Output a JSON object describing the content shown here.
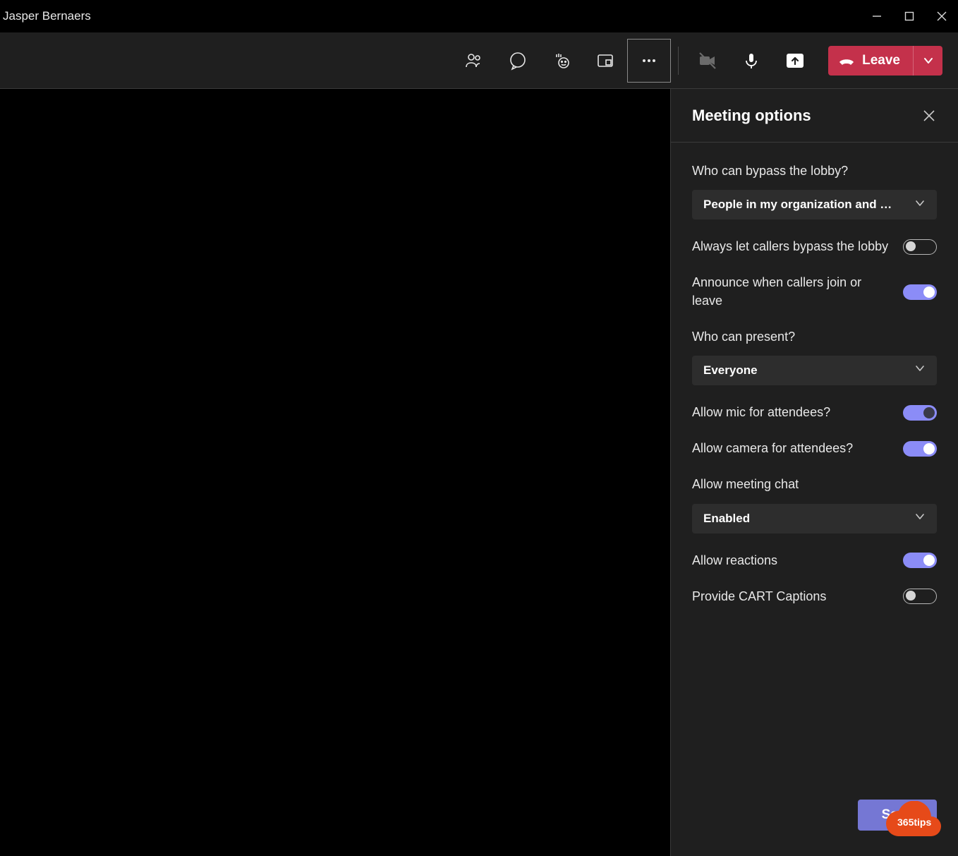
{
  "titlebar": {
    "title": "Jasper Bernaers"
  },
  "toolbar": {
    "leave_label": "Leave",
    "icons": {
      "people": "people-icon",
      "chat": "chat-icon",
      "reactions": "reactions-icon",
      "rooms": "rooms-icon",
      "more": "more-icon",
      "camera_off": "camera-off-icon",
      "mic": "mic-icon",
      "share": "share-icon"
    }
  },
  "panel": {
    "title": "Meeting options",
    "options": {
      "bypass_lobby": {
        "label": "Who can bypass the lobby?",
        "selected": "People in my organization and …"
      },
      "callers_bypass": {
        "label": "Always let callers bypass the lobby",
        "value": false
      },
      "announce": {
        "label": "Announce when callers join or leave",
        "value": true
      },
      "present": {
        "label": "Who can present?",
        "selected": "Everyone"
      },
      "allow_mic": {
        "label": "Allow mic for attendees?",
        "value": true
      },
      "allow_camera": {
        "label": "Allow camera for attendees?",
        "value": true
      },
      "meeting_chat": {
        "label": "Allow meeting chat",
        "selected": "Enabled"
      },
      "allow_reactions": {
        "label": "Allow reactions",
        "value": true
      },
      "cart_captions": {
        "label": "Provide CART Captions",
        "value": false
      }
    },
    "save_label": "Save"
  },
  "watermark": {
    "text": "365tips"
  }
}
